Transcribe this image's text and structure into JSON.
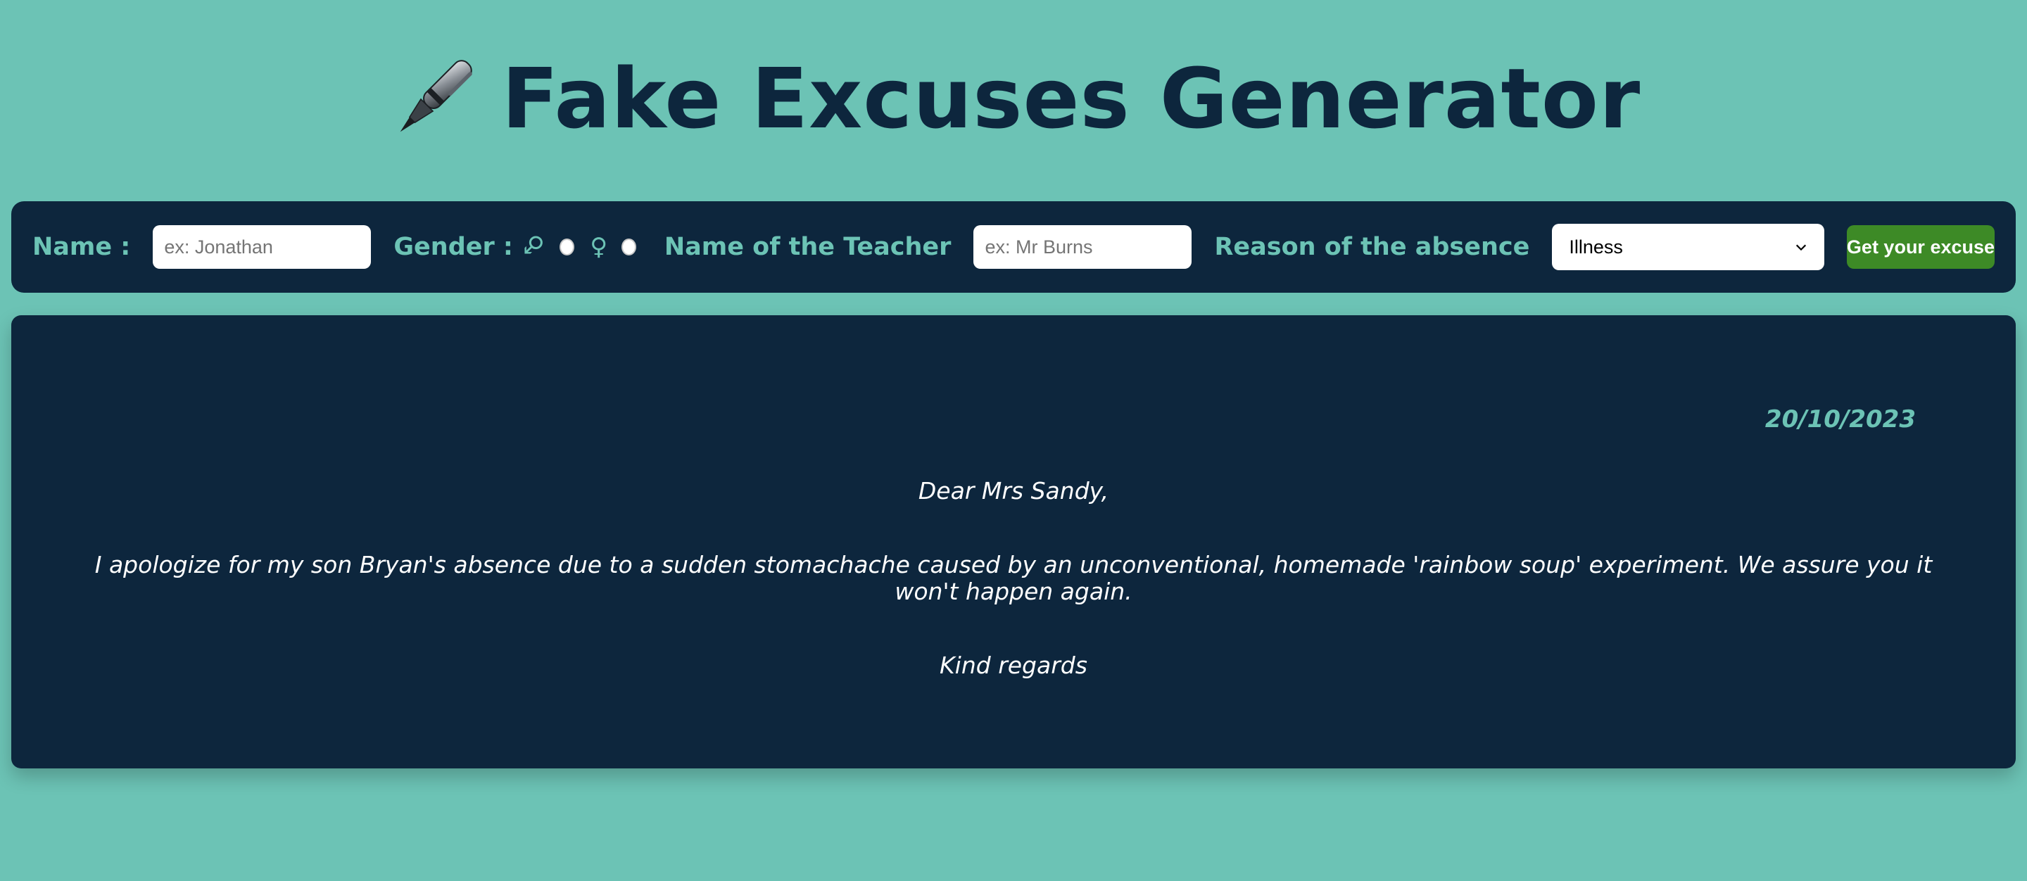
{
  "header": {
    "title": "Fake Excuses Generator",
    "icon": "fountain-pen-icon"
  },
  "form": {
    "name_label": "Name :",
    "name_placeholder": "ex: Jonathan",
    "gender_label": "Gender :",
    "male_symbol": "♂",
    "female_symbol": "♀",
    "teacher_label": "Name of the Teacher",
    "teacher_placeholder": "ex: Mr Burns",
    "reason_label": "Reason of the absence",
    "reason_selected": "Illness",
    "submit_label": "Get your excuse"
  },
  "letter": {
    "date": "20/10/2023",
    "greeting": "Dear Mrs Sandy,",
    "body": "I apologize for my son Bryan's absence due to a sudden stomachache caused by an unconventional, homemade 'rainbow soup' experiment. We assure you it won't happen again.",
    "closing": "Kind regards"
  },
  "colors": {
    "background": "#6cc3b5",
    "panel": "#0d263d",
    "accent": "#6cc3b5",
    "button": "#3d8a26"
  }
}
